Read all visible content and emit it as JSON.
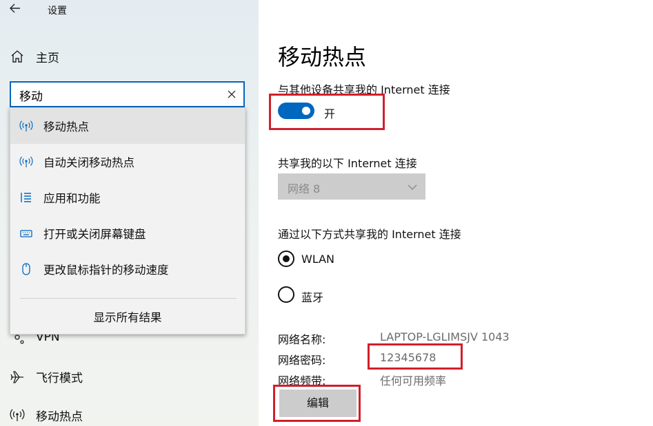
{
  "window": {
    "title": "设置"
  },
  "sidebar": {
    "home_label": "主页",
    "search": {
      "value": "移动"
    },
    "suggestions": [
      {
        "label": "移动热点",
        "icon": "hotspot-icon"
      },
      {
        "label": "自动关闭移动热点",
        "icon": "hotspot-icon"
      },
      {
        "label": "应用和功能",
        "icon": "list-icon"
      },
      {
        "label": "打开或关闭屏幕键盘",
        "icon": "keyboard-icon"
      },
      {
        "label": "更改鼠标指针的移动速度",
        "icon": "mouse-icon"
      }
    ],
    "show_all_label": "显示所有结果",
    "nav_items": [
      {
        "label": "VPN",
        "icon": "vpn-icon"
      },
      {
        "label": "飞行模式",
        "icon": "airplane-icon"
      },
      {
        "label": "移动热点",
        "icon": "hotspot-icon"
      }
    ]
  },
  "main": {
    "title": "移动热点",
    "share_heading": "与其他设备共享我的 Internet 连接",
    "toggle": {
      "state": "on",
      "label": "开"
    },
    "share_from_heading": "共享我的以下 Internet 连接",
    "share_from_select": {
      "value": "网络 8"
    },
    "share_via_heading": "通过以下方式共享我的 Internet 连接",
    "share_via_options": [
      {
        "label": "WLAN",
        "selected": true
      },
      {
        "label": "蓝牙",
        "selected": false
      }
    ],
    "properties": [
      {
        "label": "网络名称:",
        "value": "LAPTOP-LGLIMSJV 1043"
      },
      {
        "label": "网络密码:",
        "value": "12345678"
      },
      {
        "label": "网络频带:",
        "value": "任何可用频率"
      }
    ],
    "edit_label": "编辑"
  },
  "colors": {
    "accent": "#0067c0",
    "highlight_box": "#d21e2b"
  }
}
